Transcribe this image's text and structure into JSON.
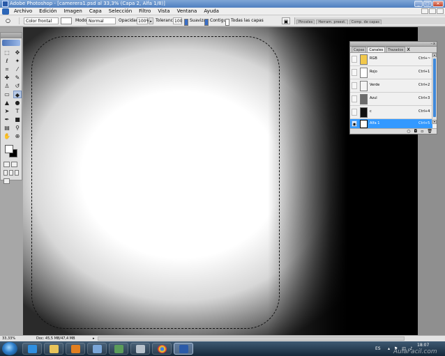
{
  "window": {
    "title": "Adobe Photoshop - [camerera1.psd al 33,3% (Capa 2, Alfa 1/8)]",
    "controls": [
      "_",
      "□",
      "✕"
    ]
  },
  "menubar": {
    "items": [
      "Archivo",
      "Edición",
      "Imagen",
      "Capa",
      "Selección",
      "Filtro",
      "Vista",
      "Ventana",
      "Ayuda"
    ]
  },
  "options": {
    "fill_source": "Color frontal",
    "mode_label": "Modo:",
    "mode_value": "Normal",
    "opacity_label": "Opacidad:",
    "opacity_value": "100%",
    "tolerance_label": "Tolerancia:",
    "tolerance_value": "100",
    "smooth_label": "Suavizar",
    "smooth_checked": true,
    "contiguous_label": "Contiguo",
    "contiguous_checked": true,
    "all_layers_label": "Todas las capas",
    "all_layers_checked": false,
    "dock_tabs": [
      "Pinceles",
      "Herram. preest.",
      "Comp. de capas"
    ]
  },
  "channels_panel": {
    "tabs": [
      "Capas",
      "Canales",
      "Trazados"
    ],
    "active_tab": "Canales",
    "close_glyph": "x",
    "rows": [
      {
        "name": "RGB",
        "shortcut": "Ctrl+~",
        "thumb_color": "#f2c84b",
        "visible": false,
        "selected": false
      },
      {
        "name": "Rojo",
        "shortcut": "Ctrl+1",
        "thumb_color": "#ffffff",
        "visible": false,
        "selected": false
      },
      {
        "name": "Verde",
        "shortcut": "Ctrl+2",
        "thumb_color": "#f4f4f4",
        "visible": false,
        "selected": false
      },
      {
        "name": "Azul",
        "shortcut": "Ctrl+3",
        "thumb_color": "#6b6b6b",
        "visible": false,
        "selected": false
      },
      {
        "name": "c",
        "shortcut": "Ctrl+4",
        "thumb_color": "#111111",
        "visible": false,
        "selected": false
      },
      {
        "name": "Alfa 1",
        "shortcut": "Ctrl+5",
        "thumb_color": "#ffffff",
        "visible": true,
        "selected": true
      }
    ],
    "footer_icons": [
      "selection-circle-icon",
      "save-selection-icon",
      "new-channel-icon",
      "trash-icon"
    ]
  },
  "statusbar": {
    "zoom": "33,33%",
    "doc_info": "Doc: 45,5 MB/47,4 MB"
  },
  "taskbar": {
    "lang": "ES",
    "time": "18:07",
    "watermark": "AulaFacil.com"
  },
  "colors": {
    "selection_blue": "#3399ff",
    "foreground": "#ffffff",
    "background": "#000000"
  }
}
